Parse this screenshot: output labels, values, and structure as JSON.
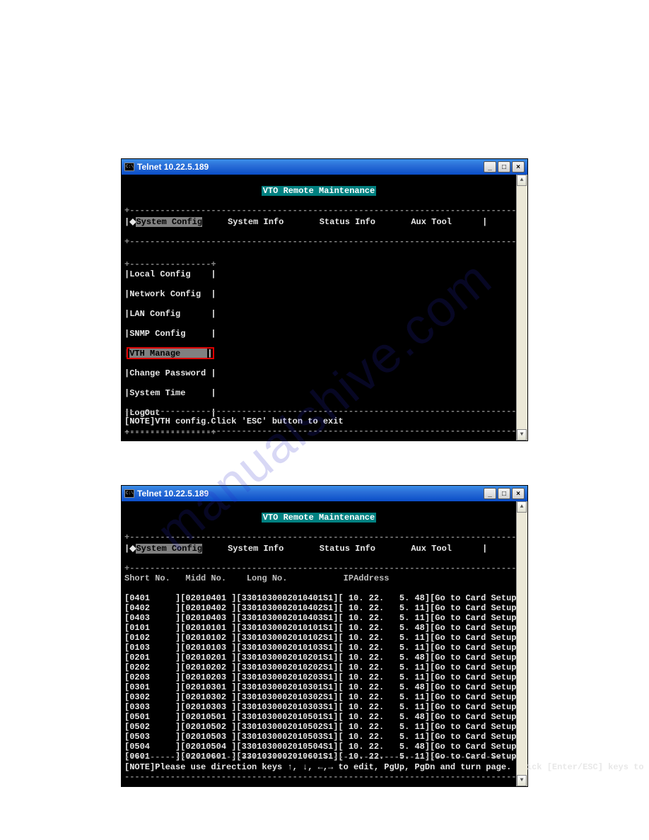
{
  "watermark_text": "manualshive.com",
  "window1": {
    "title": "Telnet 10.22.5.189",
    "header": "VTO Remote Maintenance",
    "tabs": [
      "System Config",
      "System Info",
      "Status Info",
      "Aux Tool"
    ],
    "active_tab": "System Config",
    "submenu": [
      "Local Config",
      "Network Config",
      "LAN Config",
      "SNMP Config",
      "VTH Manage",
      "Change Password",
      "System Time",
      "LogOut"
    ],
    "selected_item": "VTH Manage",
    "note": "[NOTE]VTH config.Click 'ESC' button to exit"
  },
  "window2": {
    "title": "Telnet 10.22.5.189",
    "header": "VTO Remote Maintenance",
    "tabs": [
      "System Config",
      "System Info",
      "Status Info",
      "Aux Tool"
    ],
    "active_tab": "System Config",
    "columns": [
      "Short No.",
      "Midd No.",
      "Long No.",
      "IPAddress"
    ],
    "rows": [
      {
        "short": "0401",
        "mid": "02010401",
        "long": "3301030002010401S1",
        "ip": "10. 22.   5. 48",
        "action": "Go to Card Setup.."
      },
      {
        "short": "0402",
        "mid": "02010402",
        "long": "3301030002010402S1",
        "ip": "10. 22.   5. 11",
        "action": "Go to Card Setup.."
      },
      {
        "short": "0403",
        "mid": "02010403",
        "long": "3301030002010403S1",
        "ip": "10. 22.   5. 11",
        "action": "Go to Card Setup.."
      },
      {
        "short": "0101",
        "mid": "02010101",
        "long": "3301030002010101S1",
        "ip": "10. 22.   5. 48",
        "action": "Go to Card Setup.."
      },
      {
        "short": "0102",
        "mid": "02010102",
        "long": "3301030002010102S1",
        "ip": "10. 22.   5. 11",
        "action": "Go to Card Setup.."
      },
      {
        "short": "0103",
        "mid": "02010103",
        "long": "3301030002010103S1",
        "ip": "10. 22.   5. 11",
        "action": "Go to Card Setup.."
      },
      {
        "short": "0201",
        "mid": "02010201",
        "long": "3301030002010201S1",
        "ip": "10. 22.   5. 48",
        "action": "Go to Card Setup.."
      },
      {
        "short": "0202",
        "mid": "02010202",
        "long": "3301030002010202S1",
        "ip": "10. 22.   5. 11",
        "action": "Go to Card Setup.."
      },
      {
        "short": "0203",
        "mid": "02010203",
        "long": "3301030002010203S1",
        "ip": "10. 22.   5. 11",
        "action": "Go to Card Setup.."
      },
      {
        "short": "0301",
        "mid": "02010301",
        "long": "3301030002010301S1",
        "ip": "10. 22.   5. 48",
        "action": "Go to Card Setup.."
      },
      {
        "short": "0302",
        "mid": "02010302",
        "long": "3301030002010302S1",
        "ip": "10. 22.   5. 11",
        "action": "Go to Card Setup.."
      },
      {
        "short": "0303",
        "mid": "02010303",
        "long": "3301030002010303S1",
        "ip": "10. 22.   5. 11",
        "action": "Go to Card Setup.."
      },
      {
        "short": "0501",
        "mid": "02010501",
        "long": "3301030002010501S1",
        "ip": "10. 22.   5. 48",
        "action": "Go to Card Setup.."
      },
      {
        "short": "0502",
        "mid": "02010502",
        "long": "3301030002010502S1",
        "ip": "10. 22.   5. 11",
        "action": "Go to Card Setup.."
      },
      {
        "short": "0503",
        "mid": "02010503",
        "long": "3301030002010503S1",
        "ip": "10. 22.   5. 11",
        "action": "Go to Card Setup.."
      },
      {
        "short": "0504",
        "mid": "02010504",
        "long": "3301030002010504S1",
        "ip": "10. 22.   5. 48",
        "action": "Go to Card Setup.."
      },
      {
        "short": "0601",
        "mid": "02010601",
        "long": "3301030002010601S1",
        "ip": "10. 22.   5. 11",
        "action": "Go to Card Setup.."
      }
    ],
    "note": "[NOTE]Please use direction keys ↑, ↓, ←,→ to edit, PgUp, PgDn and turn page. Click [Enter/ESC] keys to edit or exit edit."
  },
  "btn_min": "_",
  "btn_max": "□",
  "btn_close": "×",
  "arrow_up": "▲",
  "arrow_down": "▼"
}
